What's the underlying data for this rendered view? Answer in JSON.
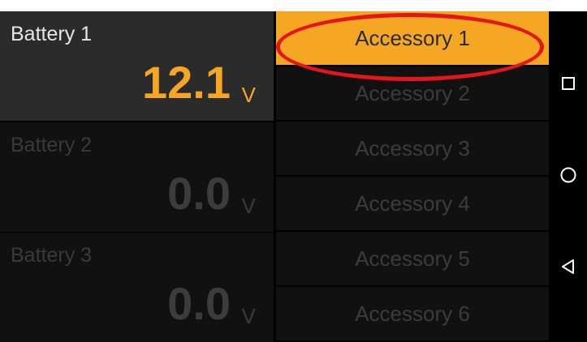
{
  "batteries": [
    {
      "name": "Battery 1",
      "value": "12.1",
      "unit": "V",
      "active": true
    },
    {
      "name": "Battery 2",
      "value": "0.0",
      "unit": "V",
      "active": false
    },
    {
      "name": "Battery 3",
      "value": "0.0",
      "unit": "V",
      "active": false
    }
  ],
  "accessories": [
    {
      "label": "Accessory 1",
      "active": true
    },
    {
      "label": "Accessory 2",
      "active": false
    },
    {
      "label": "Accessory 3",
      "active": false
    },
    {
      "label": "Accessory 4",
      "active": false
    },
    {
      "label": "Accessory 5",
      "active": false
    },
    {
      "label": "Accessory 6",
      "active": false
    }
  ],
  "navbar": {
    "buttons": [
      "recents-square-icon",
      "home-circle-icon",
      "back-triangle-icon"
    ]
  },
  "colors": {
    "accent": "#f5a623",
    "highlight_ring": "#e3161b",
    "background": "#000000"
  }
}
